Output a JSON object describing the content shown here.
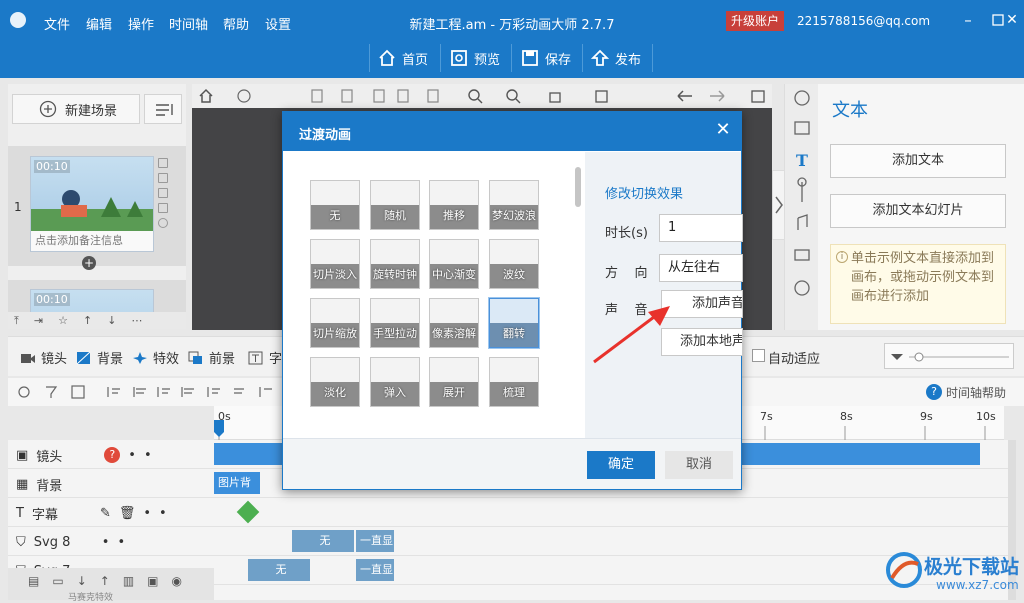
{
  "app": {
    "title": "新建工程.am - 万彩动画大师 2.7.7",
    "upgrade": "升级账户",
    "account": "2215788156@qq.com"
  },
  "menu": [
    "文件",
    "编辑",
    "操作",
    "时间轴",
    "帮助",
    "设置"
  ],
  "toolbar": {
    "home": "首页",
    "preview": "预览",
    "save": "保存",
    "publish": "发布"
  },
  "scene_panel": {
    "new_scene": "新建场景",
    "scene_index": "1",
    "thumb_time_1": "00:10",
    "thumb_time_2": "00:10",
    "note_placeholder": "点击添加备注信息"
  },
  "right_panel": {
    "title": "文本",
    "add_text": "添加文本",
    "add_text_slide": "添加文本幻灯片",
    "tip": "单击示例文本直接添加到画布，或拖动示例文本到画布进行添加"
  },
  "mode_bar": {
    "items": [
      "镜头",
      "背景",
      "特效",
      "前景",
      "字"
    ],
    "auto_fit": "自动适应"
  },
  "timeline": {
    "help": "时间轴帮助",
    "ticks": [
      "0s",
      "7s",
      "8s",
      "9s",
      "10s"
    ],
    "tracks": [
      {
        "name": "镜头"
      },
      {
        "name": "背景",
        "block": "图片背"
      },
      {
        "name": "字幕"
      },
      {
        "name": "Svg 8",
        "block1": "无",
        "block2": "一直显"
      },
      {
        "name": "Svg 7",
        "block1": "无",
        "block2": "一直显"
      },
      {
        "name": "马赛克特效"
      }
    ]
  },
  "dialog": {
    "title": "过渡动画",
    "effects": [
      "无",
      "随机",
      "推移",
      "梦幻波浪",
      "切片淡入",
      "旋转时钟",
      "中心渐变",
      "波纹",
      "切片缩放",
      "手型拉动",
      "像素溶解",
      "翻转",
      "淡化",
      "弹入",
      "展开",
      "梳理"
    ],
    "selected_effect": "翻转",
    "section_title": "修改切换效果",
    "duration_label": "时长(s)",
    "duration_value": "1",
    "direction_label": "方    向",
    "direction_value": "从左往右",
    "sound_label": "声    音",
    "add_sound": "添加声音",
    "add_local_sound": "添加本地声",
    "ok": "确定",
    "cancel": "取消"
  },
  "watermark": {
    "text": "极光下载站",
    "url": "www.xz7.com"
  },
  "colors": {
    "brand": "#1b79c8",
    "upgrade": "#c8403a",
    "arrow": "#e8322c",
    "track_block": "#3b8fdc"
  }
}
